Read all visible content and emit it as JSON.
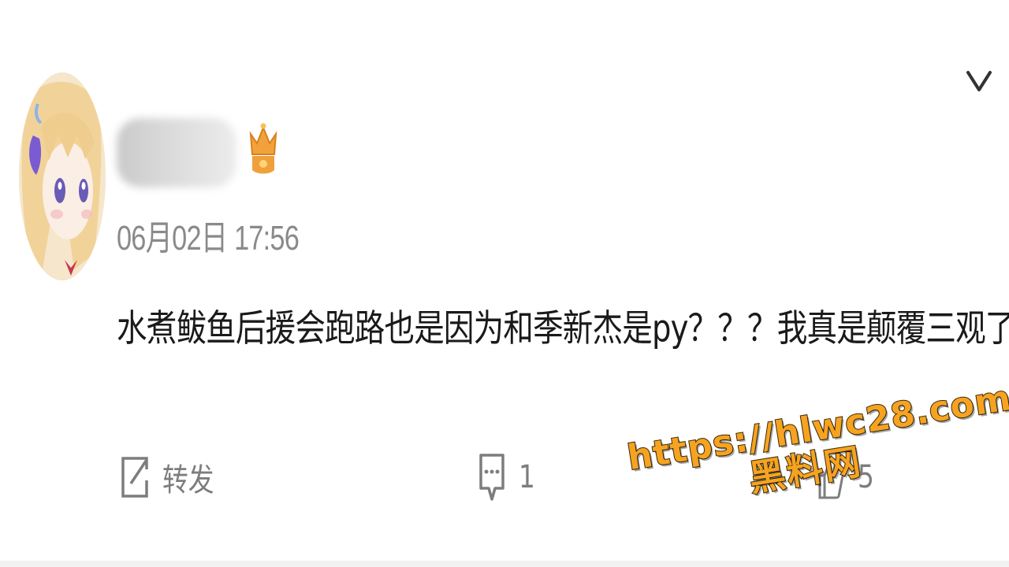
{
  "post": {
    "username": "",
    "timestamp": "06月02日 17:56",
    "text": "水煮鲅鱼后援会跑路也是因为和季新杰是py？？？我真是颠覆三观了"
  },
  "actions": {
    "forward_label": "转发",
    "comment_count": "1",
    "like_count": "5"
  },
  "icons": {
    "menu": "chevron-down-icon",
    "badge": "vip-crown-icon",
    "forward": "share-icon",
    "comment": "comment-icon",
    "like": "thumbs-up-icon"
  },
  "watermark": {
    "url": "https://hlwc28.com",
    "name": "黑料网"
  },
  "colors": {
    "text_primary": "#1a1a1a",
    "text_secondary": "#8a8a8a",
    "watermark": "#f6a321",
    "badge": "#f2a23a"
  }
}
